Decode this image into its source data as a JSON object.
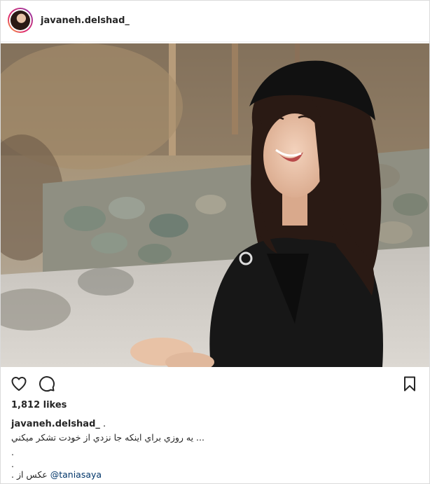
{
  "post": {
    "username": "javaneh.delshad_",
    "likes": "1,812 likes",
    "caption_username": "javaneh.delshad_",
    "caption_suffix": " .",
    "caption_text": "... يه روزي براي اينكه جا نزدي از خودت تشكر ميكني",
    "dot_line_1": ".",
    "dot_line_2": ".",
    "credit_text": "عكس از .",
    "credit_mention": "@taniasaya"
  },
  "icons": {
    "avatar": "avatar-icon",
    "like": "heart-icon",
    "comment": "comment-icon",
    "save": "bookmark-icon"
  },
  "colors": {
    "text": "#262626",
    "mention": "#003569",
    "border": "#dbdbdb",
    "story_ring_start": "#f9c03b",
    "story_ring_end": "#833ab4"
  }
}
